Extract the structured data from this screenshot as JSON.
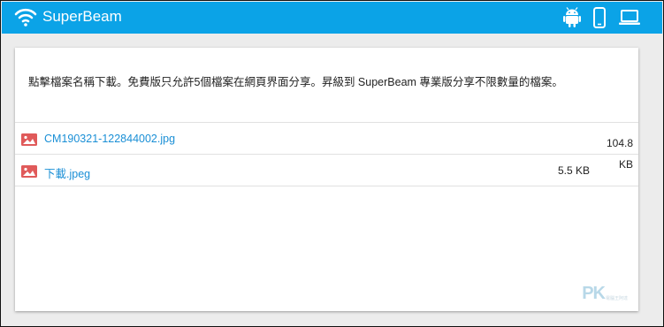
{
  "app": {
    "name": "SuperBeam",
    "brand_color": "#0ba3e7"
  },
  "header": {
    "platform_icons": [
      "android-icon",
      "phone-icon",
      "laptop-icon"
    ]
  },
  "main": {
    "notice": "點擊檔案名稱下載。免費版只允許5個檔案在網頁界面分享。昇級到 SuperBeam 專業版分享不限數量的檔案。",
    "files": [
      {
        "name": "CM190321-122844002.jpg",
        "size": "104.8 KB",
        "icon": "image-icon"
      },
      {
        "name": "下載.jpeg",
        "size": "5.5 KB",
        "icon": "image-icon"
      }
    ]
  },
  "watermark": {
    "text": "PK",
    "subtext": "電腦王阿達"
  }
}
